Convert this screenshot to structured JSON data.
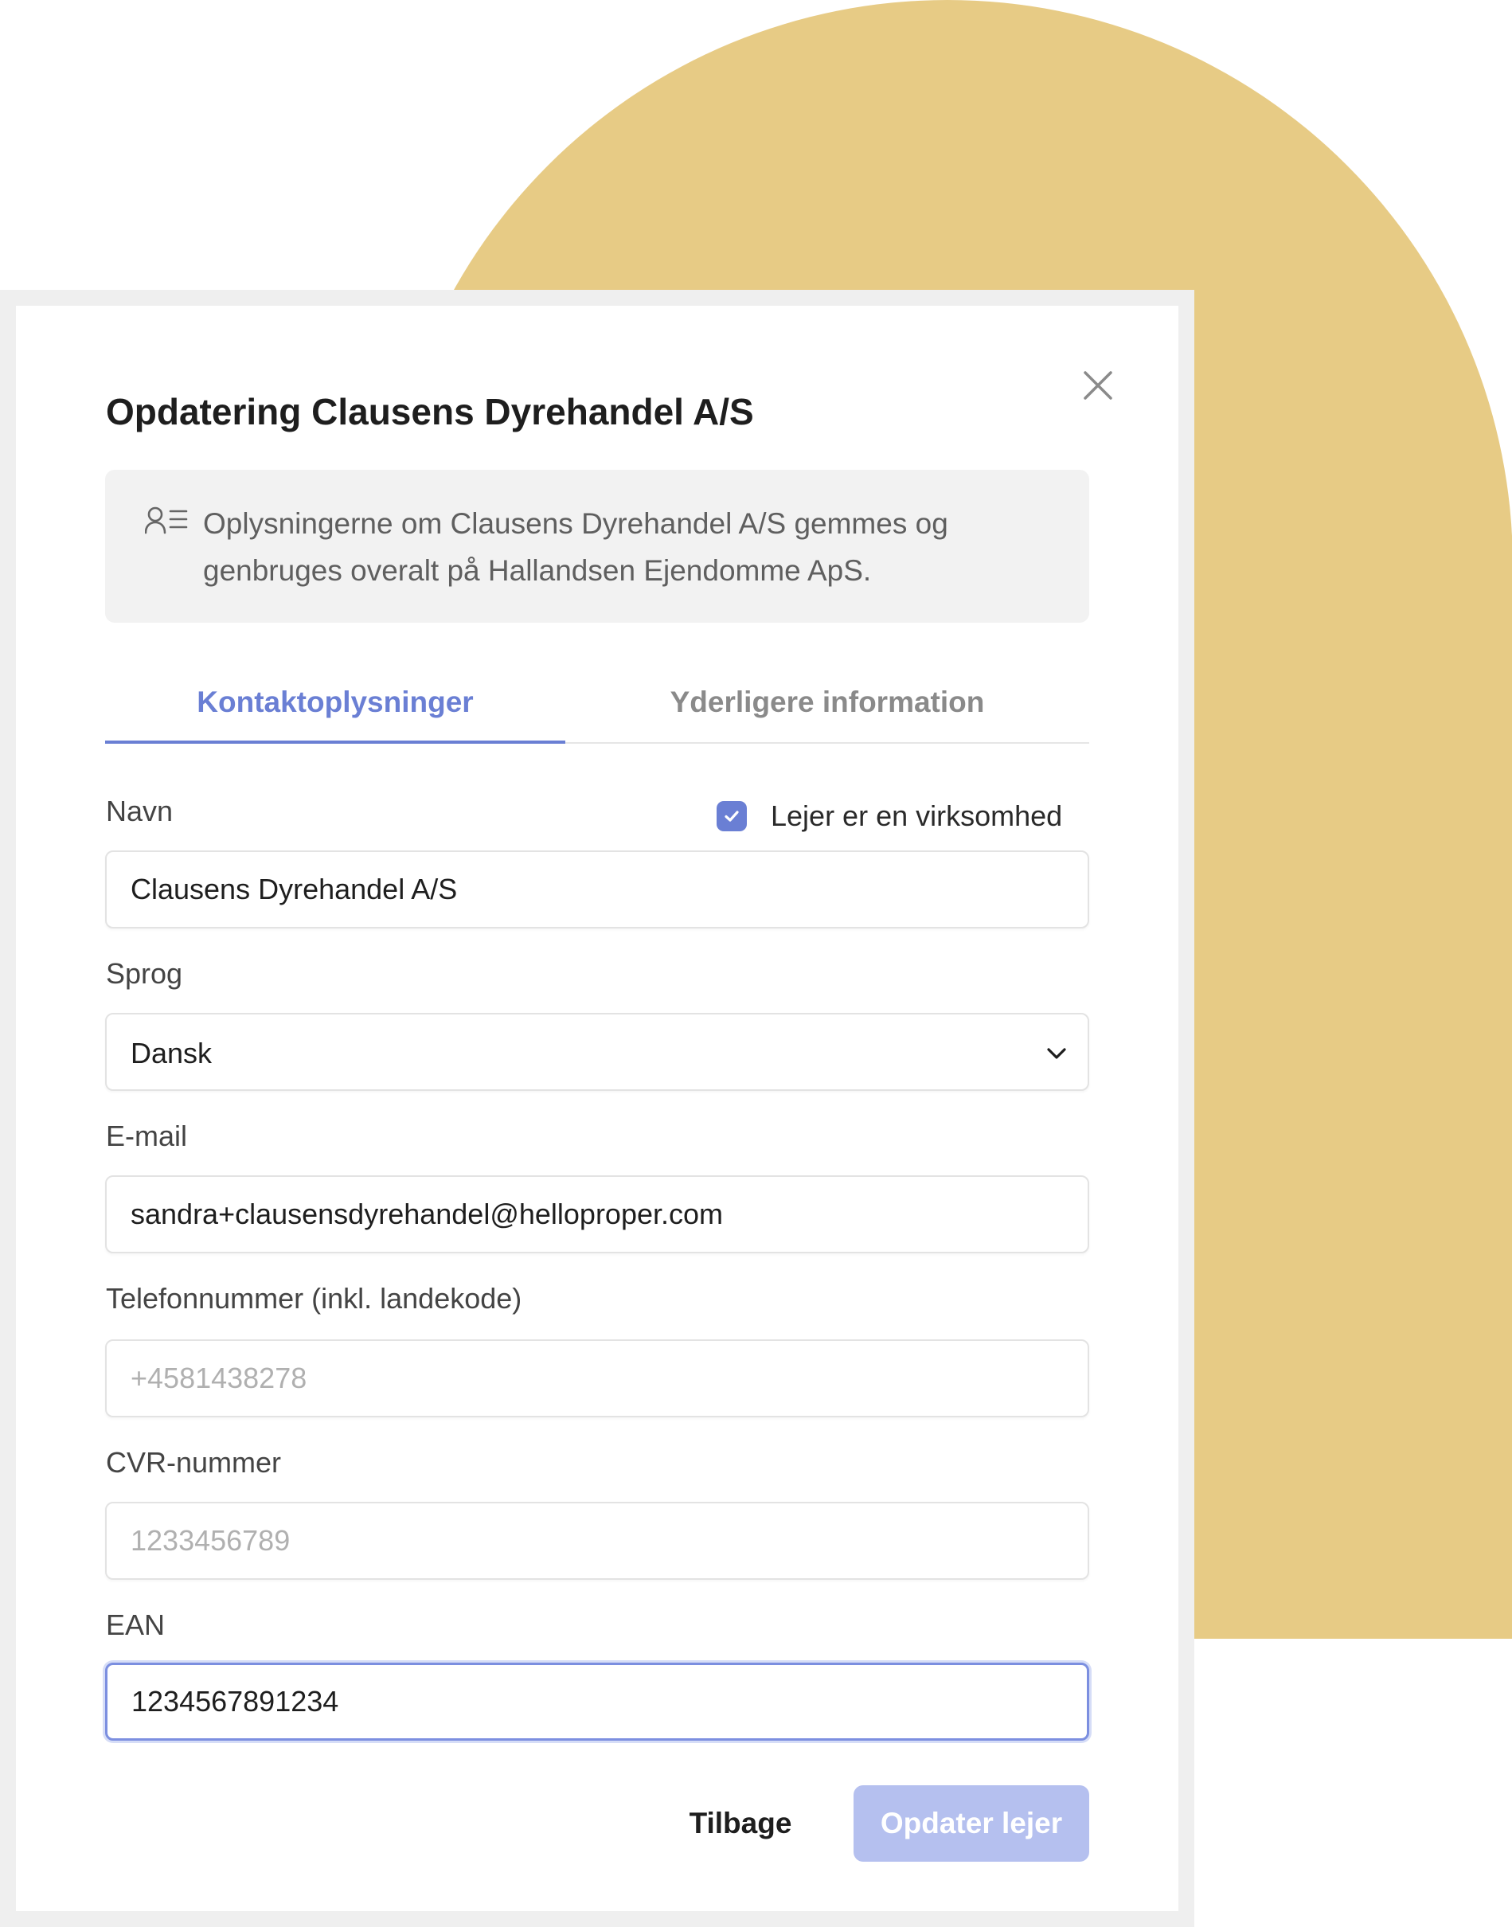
{
  "modal": {
    "title": "Opdatering Clausens Dyrehandel A/S",
    "close_icon": "close-icon"
  },
  "info": {
    "icon": "contact-list-icon",
    "text": "Oplysningerne om Clausens Dyrehandel A/S gemmes og genbruges overalt på Hallandsen Ejendomme ApS."
  },
  "tabs": [
    {
      "label": "Kontaktoplysninger",
      "active": true
    },
    {
      "label": "Yderligere information",
      "active": false
    }
  ],
  "form": {
    "name": {
      "label": "Navn",
      "value": "Clausens Dyrehandel A/S"
    },
    "is_business": {
      "label": "Lejer er en virksomhed",
      "checked": true
    },
    "language": {
      "label": "Sprog",
      "value": "Dansk"
    },
    "email": {
      "label": "E-mail",
      "value": "sandra+clausensdyrehandel@helloproper.com"
    },
    "phone": {
      "label": "Telefonnummer (inkl. landekode)",
      "placeholder": "+4581438278"
    },
    "cvr": {
      "label": "CVR-nummer",
      "placeholder": "1233456789"
    },
    "ean": {
      "label": "EAN",
      "value": "1234567891234",
      "focused": true
    }
  },
  "actions": {
    "back_label": "Tilbage",
    "submit_label": "Opdater lejer"
  },
  "colors": {
    "accent": "#6a7fd4",
    "accent_disabled": "#b5c0ef",
    "background_decoration": "#e7cb85",
    "info_box": "#f2f2f2"
  }
}
